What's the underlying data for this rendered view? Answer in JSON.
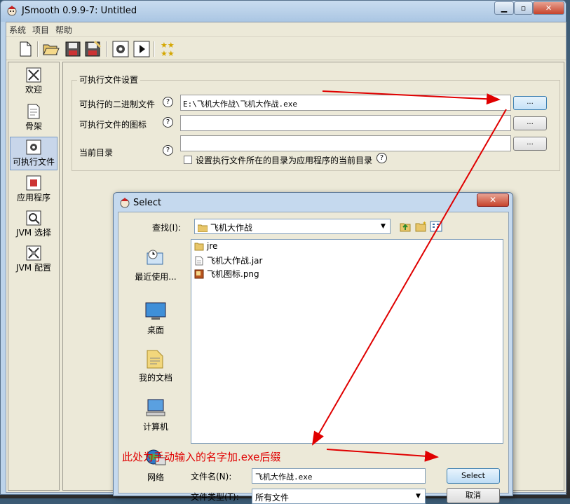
{
  "window": {
    "title": "JSmooth 0.9.9-7: Untitled"
  },
  "menu": [
    "系统",
    "项目",
    "帮助"
  ],
  "toolbar": {
    "buttons": [
      "new-icon",
      "open-icon",
      "save-icon",
      "save-as-icon",
      "compile-icon",
      "run-icon",
      "about-icon"
    ]
  },
  "sidebar": {
    "items": [
      {
        "label": "欢迎",
        "icon": "welcome-icon"
      },
      {
        "label": "骨架",
        "icon": "skeleton-icon"
      },
      {
        "label": "可执行文件",
        "icon": "executable-icon",
        "active": true
      },
      {
        "label": "应用程序",
        "icon": "application-icon"
      },
      {
        "label": "JVM 选择",
        "icon": "jvm-select-icon"
      },
      {
        "label": "JVM 配置",
        "icon": "jvm-config-icon"
      }
    ]
  },
  "executable_settings": {
    "group_title": "可执行文件设置",
    "binary_label": "可执行的二进制文件",
    "binary_value": "E:\\飞机大作战\\飞机大作战.exe",
    "icon_label": "可执行文件的图标",
    "icon_value": "",
    "cwd_label": "当前目录",
    "cwd_value": "",
    "browse_label": "...",
    "help_glyph": "?",
    "checkbox_label": "设置执行文件所在的目录为应用程序的当前目录"
  },
  "dialog": {
    "title": "Select",
    "lookin_label": "查找(I):",
    "lookin_value": "飞机大作战",
    "places": [
      "最近使用...",
      "桌面",
      "我的文档",
      "计算机",
      "网络"
    ],
    "files": [
      {
        "name": "jre",
        "type": "folder"
      },
      {
        "name": "飞机大作战.jar",
        "type": "jar"
      },
      {
        "name": "飞机图标.png",
        "type": "png"
      }
    ],
    "filename_label": "文件名(N):",
    "filename_value": "飞机大作战.exe",
    "filetype_label": "文件类型(T):",
    "filetype_value": "所有文件",
    "select_button": "Select",
    "cancel_button": "取消",
    "close_glyph": "✕"
  },
  "annotation": {
    "text": "此处为手动输入的名字加.exe后缀",
    "color": "#e00000"
  }
}
